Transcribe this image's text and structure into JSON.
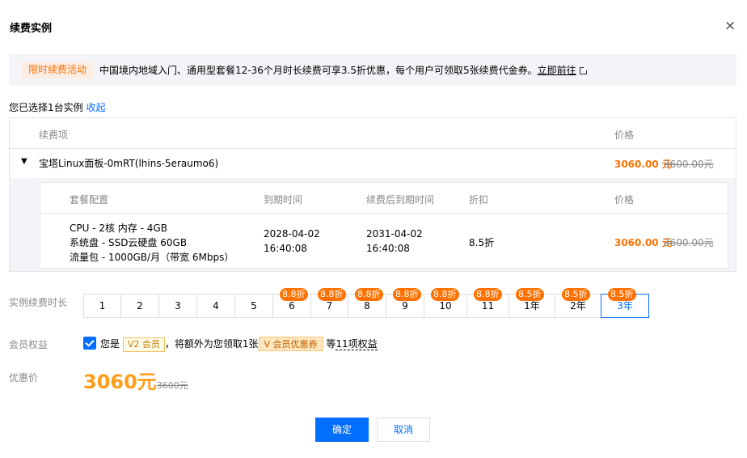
{
  "dialog": {
    "title": "续费实例",
    "close": "×"
  },
  "promo": {
    "tag": "限时续费活动",
    "text": "中国境内地域入门、通用型套餐12-36个月时长续费可享3.5折优惠，每个用户可领取5张续费代金券。",
    "link": "立即前往"
  },
  "selection": {
    "text": "您已选择1台实例",
    "collapse": "收起"
  },
  "table": {
    "col_item": "续费项",
    "col_price": "价格",
    "instance": {
      "name": "宝塔Linux面板-0mRT(lhins-5eraumo6)",
      "price": "3060.00 元",
      "original": "3600.00元"
    },
    "inner_headers": {
      "config": "套餐配置",
      "expire": "到期时间",
      "renew_expire": "续费后到期时间",
      "discount": "折扣",
      "price": "价格"
    },
    "detail": {
      "config_line1": "CPU - 2核 内存 - 4GB",
      "config_line2": "系统盘 - SSD云硬盘 60GB",
      "config_line3": "流量包 - 1000GB/月（带宽 6Mbps）",
      "expire_date": "2028-04-02",
      "expire_time": "16:40:08",
      "renew_date": "2031-04-02",
      "renew_time": "16:40:08",
      "discount": "8.5折",
      "price": "3060.00 元",
      "original": "3600.00元"
    }
  },
  "duration": {
    "label": "实例续费时长",
    "options": [
      {
        "label": "1",
        "badge": ""
      },
      {
        "label": "2",
        "badge": ""
      },
      {
        "label": "3",
        "badge": ""
      },
      {
        "label": "4",
        "badge": ""
      },
      {
        "label": "5",
        "badge": ""
      },
      {
        "label": "6",
        "badge": "8.8折"
      },
      {
        "label": "7",
        "badge": "8.8折"
      },
      {
        "label": "8",
        "badge": "8.8折"
      },
      {
        "label": "9",
        "badge": "8.8折"
      },
      {
        "label": "10",
        "badge": "8.8折"
      },
      {
        "label": "11",
        "badge": "8.8折"
      },
      {
        "label": "1年",
        "badge": "8.5折"
      },
      {
        "label": "2年",
        "badge": "8.5折"
      },
      {
        "label": "3年",
        "badge": "8.5折"
      }
    ],
    "selected": "3年"
  },
  "member": {
    "label": "会员权益",
    "prefix": "您是",
    "level_tag": "V2 会员",
    "middle": "，将额外为您领取1张",
    "coupon_tag": "V 会员优惠券",
    "suffix": "等",
    "link": "11项权益"
  },
  "final_price": {
    "label": "优惠价",
    "price": "3060元",
    "original": "3600元"
  },
  "buttons": {
    "confirm": "确定",
    "cancel": "取消"
  },
  "colors": {
    "primary": "#006eff",
    "accent": "#ff7200",
    "price": "#ff9c19"
  }
}
